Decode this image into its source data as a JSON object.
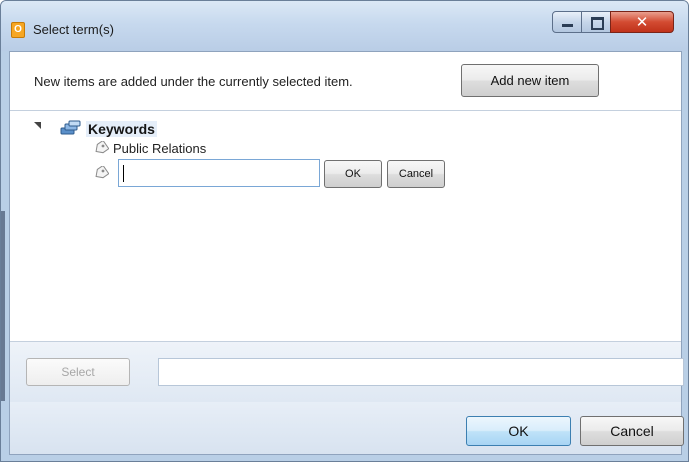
{
  "window": {
    "app_icon": "outlook-app-icon",
    "app_icon_letter": "O",
    "title": "Select term(s)",
    "controls": {
      "minimize": "minimize-icon",
      "maximize": "maximize-icon",
      "close": "close-icon",
      "close_glyph": "✕"
    }
  },
  "header": {
    "hint": "New items are added under the currently selected item.",
    "add_button": "Add new item"
  },
  "tree": {
    "root": {
      "label": "Keywords",
      "icon": "keywords-taxonomy-icon",
      "expander": "expanded-triangle-icon"
    },
    "children": [
      {
        "label": "Public Relations",
        "icon": "tag-icon"
      }
    ],
    "new_term": {
      "icon": "tag-icon",
      "value": "",
      "ok_label": "OK",
      "cancel_label": "Cancel"
    }
  },
  "selection": {
    "select_button": "Select",
    "select_button_enabled": false,
    "field_value": ""
  },
  "footer": {
    "ok_label": "OK",
    "cancel_label": "Cancel"
  },
  "colors": {
    "titlebar": "#c7d9ee",
    "close_button": "#c0321a",
    "default_button_border": "#3c7fb1",
    "selected_node": "#e5eef9"
  }
}
